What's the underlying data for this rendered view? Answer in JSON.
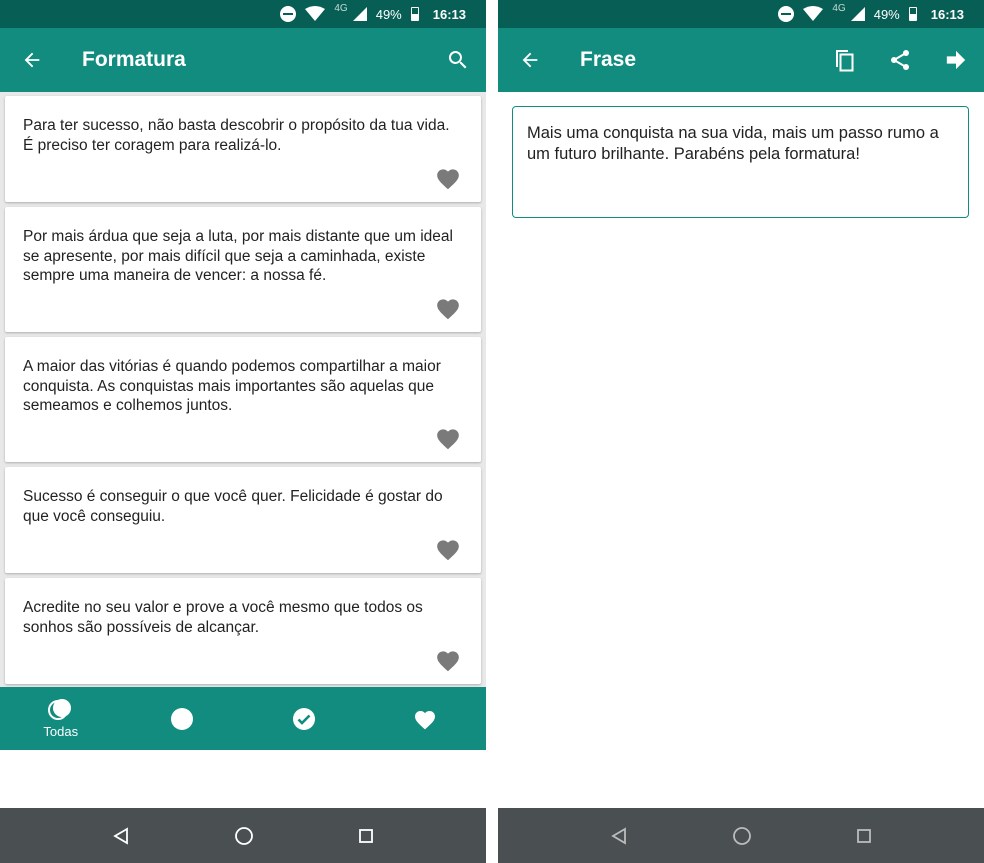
{
  "status_bar": {
    "network": "4G",
    "battery": "49%",
    "time": "16:13"
  },
  "colors": {
    "status": "#075e54",
    "primary": "#128c7e",
    "nav": "#4a4f52",
    "heart": "#7a7a7a"
  },
  "left": {
    "title": "Formatura",
    "icons": {
      "back": "arrow-left-icon",
      "search": "search-icon"
    },
    "quotes": [
      "Para ter sucesso, não basta descobrir o propósito da tua vida. É preciso ter coragem para realizá-lo.",
      "Por mais árdua que seja a luta, por mais distante que um ideal se apresente, por mais difícil que seja a caminhada, existe sempre uma maneira de vencer: a nossa fé.",
      "A maior das vitórias é quando podemos compartilhar a maior conquista. As conquistas mais importantes são aquelas que semeamos e colhemos juntos.",
      "Sucesso é conseguir o que você quer. Felicidade é gostar do que você conseguiu.",
      "Acredite no seu valor e prove a você mesmo que todos os sonhos são possíveis de alcançar."
    ],
    "tabs": {
      "all_label": "Todas"
    }
  },
  "right": {
    "title": "Frase",
    "icons": {
      "back": "arrow-left-icon",
      "copy": "copy-icon",
      "share": "share-icon",
      "next": "arrow-right-icon"
    },
    "phrase": "Mais uma conquista na sua vida, mais um passo rumo a um futuro brilhante. Parabéns pela formatura!"
  }
}
